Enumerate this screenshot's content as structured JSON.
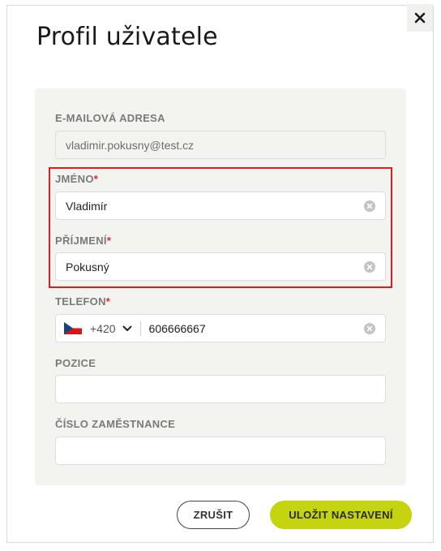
{
  "dialog": {
    "title": "Profil uživatele",
    "close_icon": "close-icon"
  },
  "form": {
    "email": {
      "label": "E-MAILOVÁ ADRESA",
      "value": "vladimir.pokusny@test.cz",
      "readonly": true
    },
    "first_name": {
      "label": "JMÉNO",
      "required_mark": "*",
      "value": "Vladimír"
    },
    "last_name": {
      "label": "PŘÍJMENÍ",
      "required_mark": "*",
      "value": "Pokusný"
    },
    "phone": {
      "label": "TELEFON",
      "required_mark": "*",
      "country_flag": "czech-flag-icon",
      "dial_code": "+420",
      "value": "606666667"
    },
    "position": {
      "label": "POZICE",
      "value": ""
    },
    "employee_number": {
      "label": "ČÍSLO ZAMĚSTNANCE",
      "value": ""
    }
  },
  "actions": {
    "cancel_label": "ZRUŠIT",
    "save_label": "ULOŽIT NASTAVENÍ"
  },
  "colors": {
    "accent": "#c5d40f",
    "required": "#e0262e",
    "highlight": "#e31b1b",
    "panel_bg": "#f3f3f0"
  }
}
